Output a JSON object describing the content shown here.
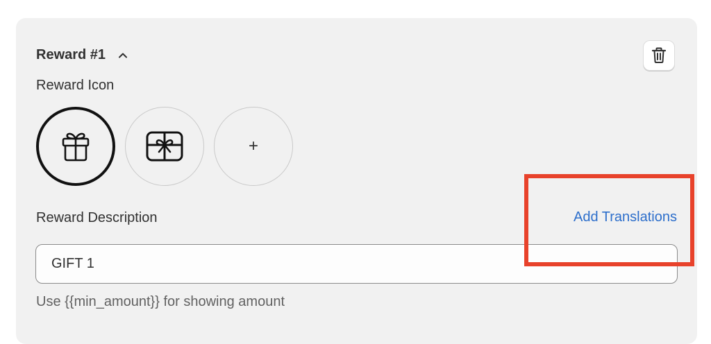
{
  "reward": {
    "title": "Reward #1",
    "collapse_icon": "chevron-up-icon",
    "delete_icon": "trash-icon"
  },
  "icon_section": {
    "label": "Reward Icon",
    "options": [
      {
        "icon": "gift-icon",
        "selected": true
      },
      {
        "icon": "gift-box-icon",
        "selected": false
      },
      {
        "icon": "plus-icon",
        "label": "+",
        "selected": false
      }
    ]
  },
  "description_section": {
    "label": "Reward Description",
    "add_translations_label": "Add Translations",
    "value": "GIFT 1",
    "help_text": "Use {{min_amount}} for showing amount"
  },
  "colors": {
    "card_background": "#f1f1f1",
    "link": "#2c6ecb",
    "highlight": "#e8422b"
  }
}
